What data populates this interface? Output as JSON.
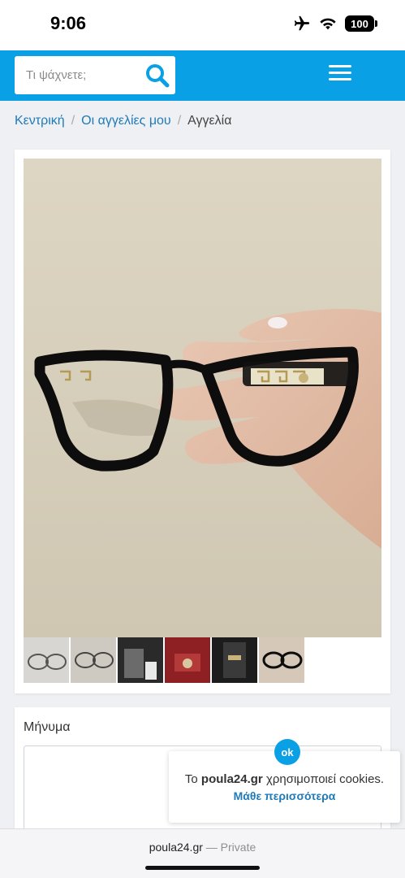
{
  "status_bar": {
    "time": "9:06",
    "battery": "100",
    "icons": [
      "airplane-icon",
      "wifi-icon",
      "battery-icon"
    ]
  },
  "header": {
    "search_placeholder": "Τι ψάχνετε;",
    "search_icon": "search-icon",
    "menu_icon": "hamburger-menu-icon",
    "bg_color": "#0aa0e6"
  },
  "breadcrumb": {
    "items": [
      {
        "label": "Κεντρική"
      },
      {
        "label": "Οι αγγελίες μου"
      }
    ],
    "current": "Αγγελία",
    "separator": "/"
  },
  "gallery": {
    "main_photo": "photo of black eyeglasses with gold greek-key temples held in hand",
    "thumbnail_count": 6
  },
  "message": {
    "label": "Μήνυμα"
  },
  "cookie_notice": {
    "ok_label": "ok",
    "prefix": "Το",
    "brand": "poula24.gr",
    "text": "χρησιμοποιεί cookies.",
    "more_link": "Μάθε περισσότερα"
  },
  "browser": {
    "domain": "poula24.gr",
    "mode": "— Private"
  }
}
